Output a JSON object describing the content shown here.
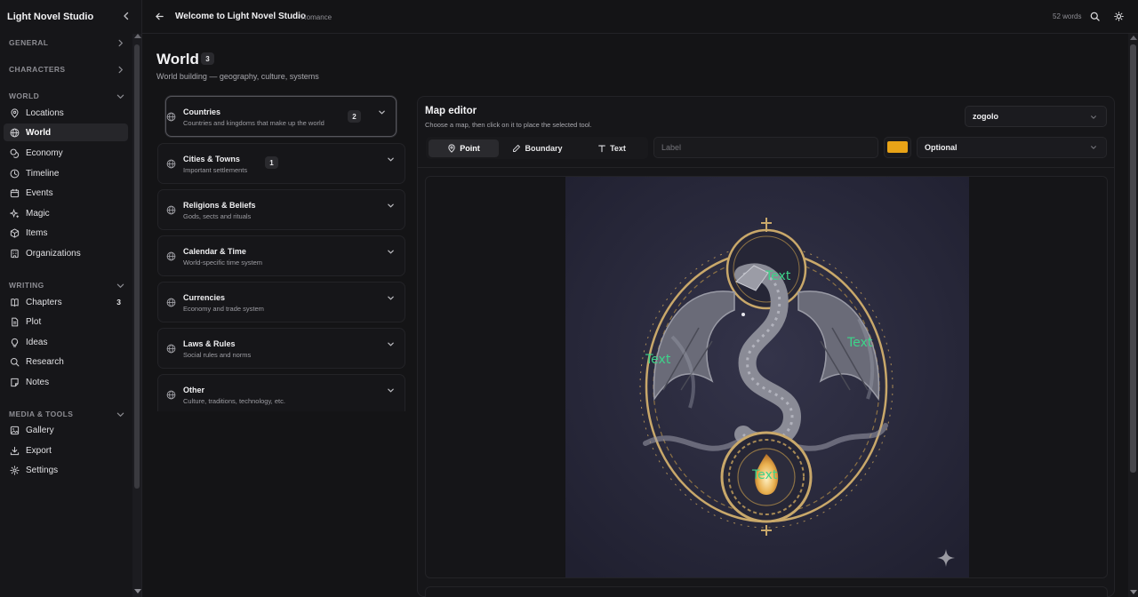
{
  "app": {
    "name": "Light Novel Studio"
  },
  "topbar": {
    "title": "Welcome to Light Novel Studio",
    "genre": "· Romance",
    "word_count": "52 words"
  },
  "sidebar": {
    "sections": [
      {
        "label": "GENERAL"
      },
      {
        "label": "CHARACTERS"
      },
      {
        "label": "WORLD",
        "items": [
          "Locations",
          "World",
          "Economy",
          "Timeline",
          "Events",
          "Magic",
          "Items",
          "Organizations"
        ]
      },
      {
        "label": "WRITING",
        "items": [
          "Chapters",
          "Plot",
          "Ideas",
          "Research",
          "Notes"
        ],
        "chapters_count": "3"
      },
      {
        "label": "MEDIA & TOOLS",
        "items": [
          "Gallery",
          "Export",
          "Settings"
        ]
      }
    ],
    "active_item": "World"
  },
  "page": {
    "title": "World",
    "count": "3",
    "subtitle": "World building — geography, culture, systems"
  },
  "categories": [
    {
      "title": "Countries",
      "desc": "Countries and kingdoms that make up the world",
      "count": "2",
      "selected": true
    },
    {
      "title": "Cities & Towns",
      "desc": "Important settlements",
      "count": "1"
    },
    {
      "title": "Religions & Beliefs",
      "desc": "Gods, sects and rituals"
    },
    {
      "title": "Calendar & Time",
      "desc": "World-specific time system"
    },
    {
      "title": "Currencies",
      "desc": "Economy and trade system"
    },
    {
      "title": "Laws & Rules",
      "desc": "Social rules and norms"
    },
    {
      "title": "Other",
      "desc": "Culture, traditions, technology, etc."
    }
  ],
  "map_editor": {
    "title": "Map editor",
    "subtitle": "Choose a map, then click on it to place the selected tool.",
    "selected_map": "zogolo",
    "tools": [
      "Point",
      "Boundary",
      "Text"
    ],
    "active_tool": "Point",
    "label_placeholder": "Label",
    "color": "#e8a317",
    "optional_value": "Optional",
    "markers": [
      "Text",
      "Text",
      "Text",
      "Text"
    ],
    "marker_color": "#3ed38a"
  }
}
